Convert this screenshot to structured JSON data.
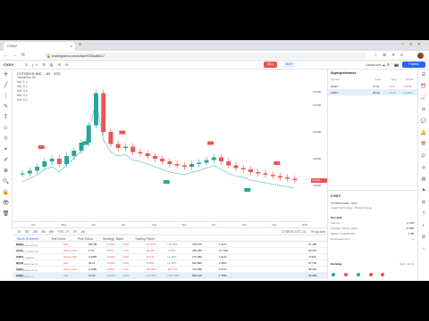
{
  "browser": {
    "tab_title": "CYDY",
    "url": "tradingview.com/chart/OOaz8bC/",
    "close_glyph": "×",
    "newtab_glyph": "+"
  },
  "toolbar": {
    "symbol": "CYDY",
    "interval_glyphs": "D  ƒx  ⊞  ▥  ⟲  ⟳",
    "right_text": "Unnamed  ☁  ⚙  ⛶  📷",
    "publish_label": "Publish"
  },
  "chart": {
    "title": "CYTODYN INC. · 1D · OTC",
    "indicator": "TrendFlex S3",
    "legend_rows": [
      "Ind. 1 v",
      "Ind. 2 v",
      "Ind. 3 v",
      "Ind. 4 v",
      "Ind. 5 v"
    ],
    "sell_label": "SELL",
    "buy_label": "BUY",
    "y_ticks": [
      "9.0000",
      "8.0000",
      "6.0000",
      "4.0000",
      "2.0000"
    ],
    "y_tick_values": [
      9,
      8,
      6,
      4,
      2
    ],
    "last_price": "2.4340",
    "x_ticks": [
      "Apr",
      "May",
      "Jun",
      "Jul",
      "Aug",
      "Sep",
      "Oct",
      "Nov",
      "Dec",
      "2021"
    ],
    "colors": {
      "up": "#26a69a",
      "down": "#ef5350",
      "accent": "#2962ff"
    }
  },
  "chart_data": {
    "type": "candlestick",
    "title": "CYTODYN INC. · 1D · OTC",
    "x_labels": [
      "Apr",
      "May",
      "Jun",
      "Jul",
      "Aug",
      "Sep",
      "Oct",
      "Nov",
      "Dec",
      "2021"
    ],
    "ylim": [
      0,
      10
    ],
    "series": [
      {
        "name": "close",
        "values": [
          2.9,
          3.1,
          3.4,
          3.8,
          4.0,
          3.6,
          4.2,
          4.6,
          5.2,
          6.5,
          8.9,
          6.0,
          5.1,
          4.8,
          4.9,
          4.5,
          4.4,
          4.2,
          4.0,
          3.8,
          3.6,
          3.5,
          3.4,
          3.6,
          3.7,
          3.9,
          4.1,
          3.8,
          3.5,
          3.3,
          3.2,
          3.0,
          2.9,
          2.8,
          2.7,
          2.6,
          2.5,
          2.4
        ]
      }
    ]
  },
  "rangebar": {
    "ranges": [
      "1D",
      "5D",
      "1M",
      "3M",
      "6M",
      "YTD",
      "1Y",
      "5Y",
      "All"
    ],
    "clock": "12:58:26 (UTC-4)",
    "flags": "%  log  auto"
  },
  "bottom_tabs": [
    "Stock Screener",
    "Text Notes",
    "Pine Editor",
    "Strategy Tester",
    "Trading Panel"
  ],
  "screener": {
    "rows": [
      {
        "ticker": "NVDA",
        "name": "NVIDIA CORPORATION",
        "signal": "Sell",
        "price": "520.99",
        "c1": "-1.98%",
        "c2": "-9.90",
        "c3": "-23.27%",
        "c4": "+33.48%",
        "c5": "789.57K",
        "c6": "6.11%",
        "c7": "37.49K"
      },
      {
        "ticker": "CCCL",
        "name": "CCCL ALL CONNECTING",
        "signal": "Strong Sell",
        "price": "2.74",
        "c1": "-5.2%",
        "c2": "-0.15",
        "c3": "-30.4%",
        "c4": "-4.79%",
        "c5": "780.25K",
        "c6": "17.79%",
        "c7": "18.67K"
      },
      {
        "ticker": "CXDY",
        "name": "CXDY INC NASDAQ",
        "signal": "Strong Sell",
        "price": "0.4650",
        "c1": "-6.68%",
        "c2": "-0.03",
        "c3": "-9.27%",
        "c4": "+1.40%",
        "c5": "776.48K",
        "c6": "1.91%",
        "c7": "-5.94K"
      },
      {
        "ticker": "NCMI",
        "name": "NCM COMMERCIAL INC",
        "signal": "Sell",
        "price": "39.11",
        "c1": "-2.06%",
        "c2": "-0.82",
        "c3": "-5.38%",
        "c4": "+1.46%",
        "c5": "626.60K",
        "c6": "2.48%",
        "c7": "97.79K"
      },
      {
        "ticker": "CXDY",
        "name": "CXDY NASDAQ GM INC",
        "signal": "Strong Sell",
        "price": "2.4180",
        "c1": "-0.85%",
        "c2": "-0.02",
        "c3": "-35.29%",
        "c4": "-28.77%",
        "c5": "711.09K",
        "c6": "6.47%",
        "c7": "58.01K"
      },
      {
        "ticker": "CXDY",
        "name": "CYTODYN INC OTC",
        "signal": "Sell",
        "price": "14.06",
        "c1": "+2.44%",
        "c2": "+0.34",
        "c3": "+17.45%",
        "c4": "+131.78%",
        "c5": "669.14K",
        "c6": "1.76%",
        "c7": "33.68K"
      }
    ]
  },
  "watchlist": {
    "title": "Superperformers",
    "cols": [
      "Symbol",
      "Last",
      "Chg",
      "Chg%"
    ],
    "rows": [
      {
        "sym": "NVDA",
        "last": "27.91",
        "chg": "-0.24",
        "pct": "-0.47%"
      },
      {
        "sym": "CXDY",
        "last": "25.10",
        "chg": "+0.43",
        "pct": "+2.46%"
      }
    ]
  },
  "details": {
    "symbol": "CYDY",
    "name": "CYTODYN INC · OTC",
    "sector": "Health Technology · Biotechnology",
    "key_stats_label": "Key data",
    "stats": [
      {
        "k": "Volume",
        "v": "1.17M"
      },
      {
        "k": "Average Volume (10d)",
        "v": "3.19M"
      },
      {
        "k": "Market Capitalization",
        "v": "1.5B"
      },
      {
        "k": "Employees (FY)",
        "v": "—"
      }
    ],
    "earnings_label": "Earnings",
    "next_label": "Next: Jul 14"
  },
  "left_tools": [
    "✛",
    "╱",
    "⋮",
    "✎",
    "T",
    "☺",
    "⟐",
    "⌖",
    "✐",
    "⊕",
    "🔍",
    "🔒",
    "👁",
    "🗑"
  ],
  "right_tools": [
    "☰",
    "⏰",
    "📈",
    "✉",
    "💬",
    "🔔",
    "📅",
    "📰",
    "◎",
    "▤",
    "⚑",
    "⊞",
    "?",
    "◐",
    "⚙",
    "⌂"
  ]
}
